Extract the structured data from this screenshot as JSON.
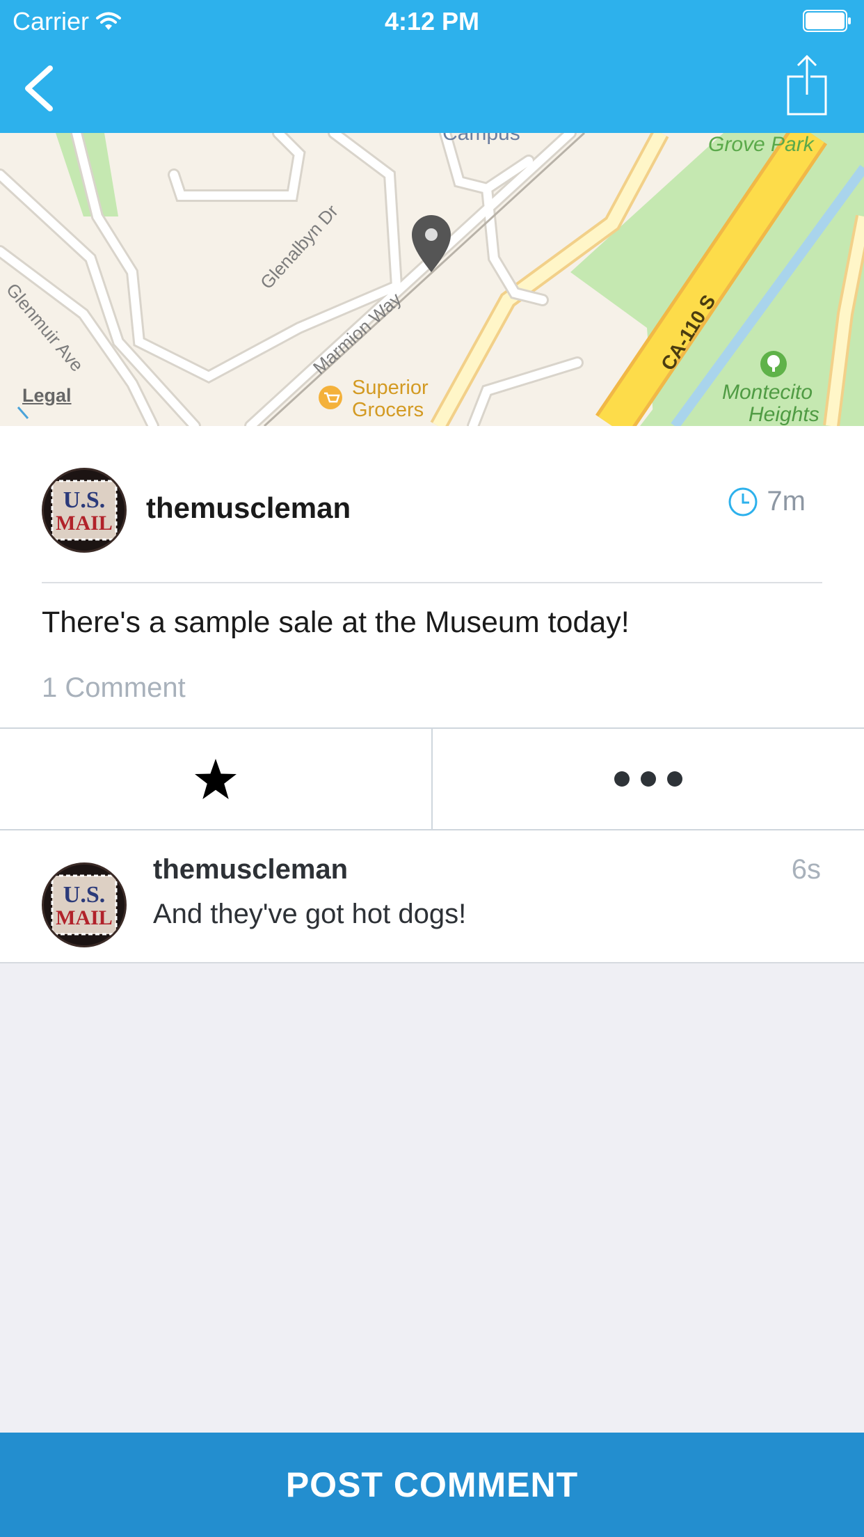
{
  "status_bar": {
    "carrier": "Carrier",
    "time": "4:12 PM"
  },
  "nav": {
    "back_icon": "chevron-left-icon",
    "share_icon": "share-icon"
  },
  "map": {
    "labels": {
      "campus": "Campus",
      "grove_park": "Grove Park",
      "glenalbyn": "Glenalbyn Dr",
      "marmion": "Marmion Way",
      "glenmuir": "Glenmuir Ave",
      "highway": "CA-110 S",
      "superior": "Superior",
      "grocers": "Grocers",
      "montecito": "Montecito",
      "heights": "Heights",
      "legal": "Legal"
    }
  },
  "post": {
    "username": "themuscleman",
    "time": "7m",
    "text": "There's a sample sale at the Museum today!",
    "comment_count": "1 Comment"
  },
  "actions": {
    "star_icon": "star-icon",
    "more_icon": "more-icon"
  },
  "comments": [
    {
      "username": "themuscleman",
      "text": "And they've got hot dogs!",
      "time": "6s"
    }
  ],
  "footer": {
    "button_label": "POST COMMENT"
  },
  "colors": {
    "header": "#2db1ec",
    "footer_button": "#238ecf",
    "background": "#efeff4"
  }
}
